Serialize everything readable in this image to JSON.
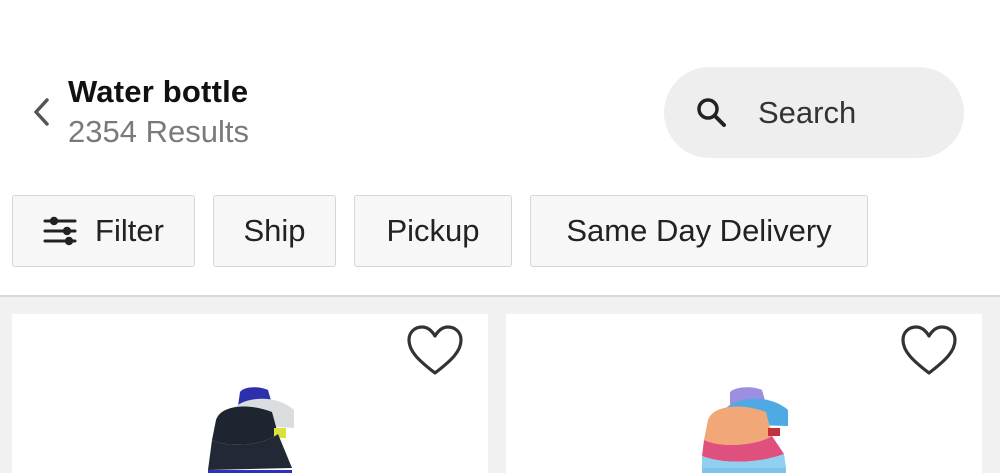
{
  "header": {
    "title": "Water bottle",
    "result_count": "2354 Results"
  },
  "search": {
    "placeholder": "Search"
  },
  "filters": [
    {
      "label": "Filter"
    },
    {
      "label": "Ship"
    },
    {
      "label": "Pickup"
    },
    {
      "label": "Same Day Delivery"
    }
  ],
  "icons": {
    "back": "chevron-left-icon",
    "search": "search-icon",
    "filter": "sliders-icon",
    "favorite": "heart-icon"
  },
  "colors": {
    "page_background": "#f1f1f1",
    "card_background": "#ffffff",
    "search_pill": "#eeeeee",
    "secondary_text": "#7a7a7a"
  }
}
